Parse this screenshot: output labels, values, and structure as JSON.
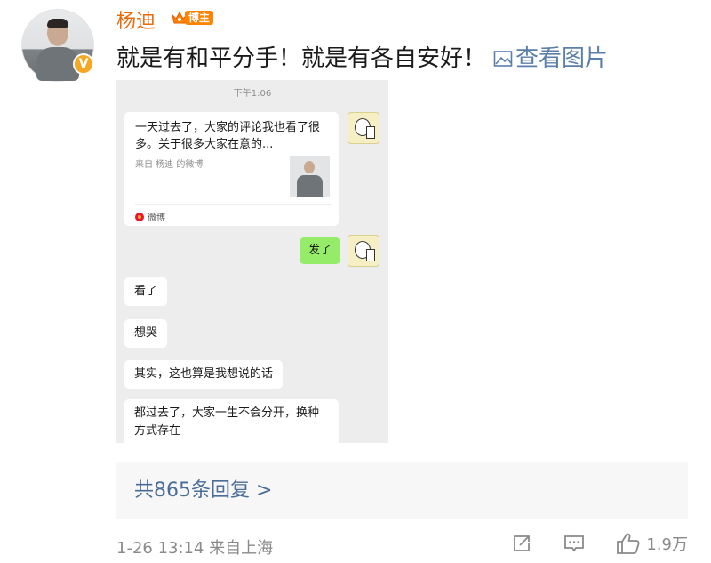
{
  "post": {
    "username": "杨迪",
    "badge_label": "博主",
    "text": "就是有和平分手！就是有各自安好！",
    "view_image_label": "查看图片",
    "verified_badge": "V",
    "icons": [
      "crown-icon",
      "image-icon",
      "verified-icon"
    ]
  },
  "chat": {
    "time": "下午1:06",
    "card": {
      "title": "一天过去了，大家的评论我也看了很多。关于很多大家在意的...",
      "source": "来自 杨迪 的微博",
      "footer": "微博"
    },
    "sent_message": "发了",
    "received_messages": [
      "看了",
      "想哭",
      "其实，这也算是我想说的话",
      "都过去了，大家一生不会分开，换种方式存在"
    ]
  },
  "replies": {
    "label": "共865条回复 >"
  },
  "meta": {
    "time_location": "1-26 13:14  来自上海",
    "like_count": "1.9万",
    "icons": [
      "repost-icon",
      "comment-icon",
      "like-icon"
    ]
  },
  "colors": {
    "username": "#e86b0c",
    "link": "#5b7fa8",
    "reply_link": "#4a6d97",
    "chat_bg": "#ededed",
    "sent_bubble": "#95ec69",
    "badge": "#ff8200"
  }
}
